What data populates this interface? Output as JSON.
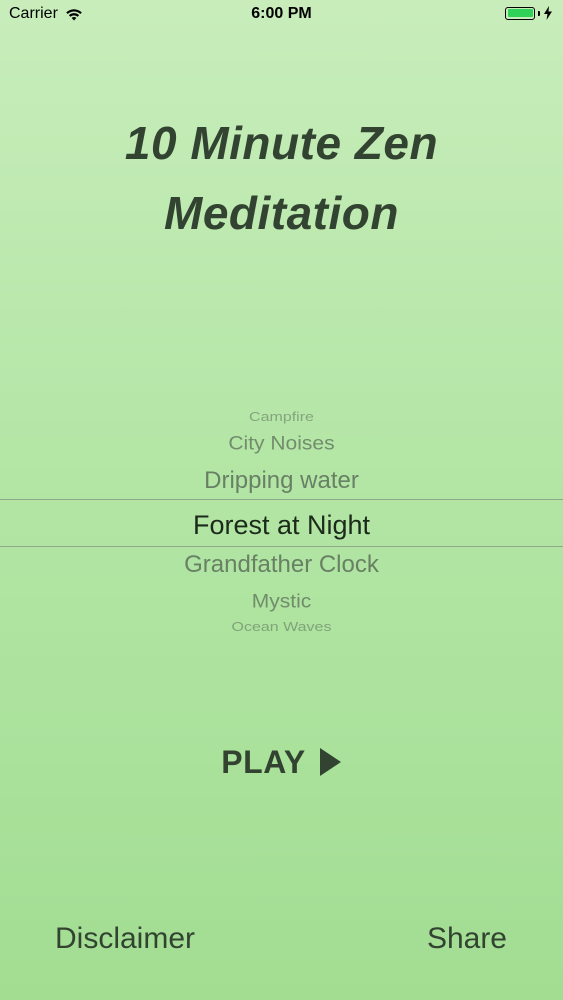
{
  "status_bar": {
    "carrier": "Carrier",
    "time": "6:00 PM",
    "battery_level": 1.0,
    "battery_color": "#2fd158",
    "icons": [
      "wifi-icon",
      "battery-icon",
      "charging-bolt-icon"
    ]
  },
  "title": {
    "line1": "10 Minute Zen",
    "line2": "Meditation"
  },
  "picker": {
    "items": [
      "Campfire",
      "City Noises",
      "Dripping water",
      "Forest at Night",
      "Grandfather Clock",
      "Mystic",
      "Ocean Waves"
    ],
    "selected": "Forest at Night"
  },
  "play": {
    "label": "PLAY",
    "icon": "play-icon"
  },
  "footer": {
    "disclaimer_label": "Disclaimer",
    "share_label": "Share"
  },
  "colors": {
    "text_dark": "#324431",
    "text_selected": "#1b2a1a",
    "picker_text": "#5c6f5a",
    "background_top": "#c8edbb",
    "background_bottom": "#a2dd92"
  }
}
